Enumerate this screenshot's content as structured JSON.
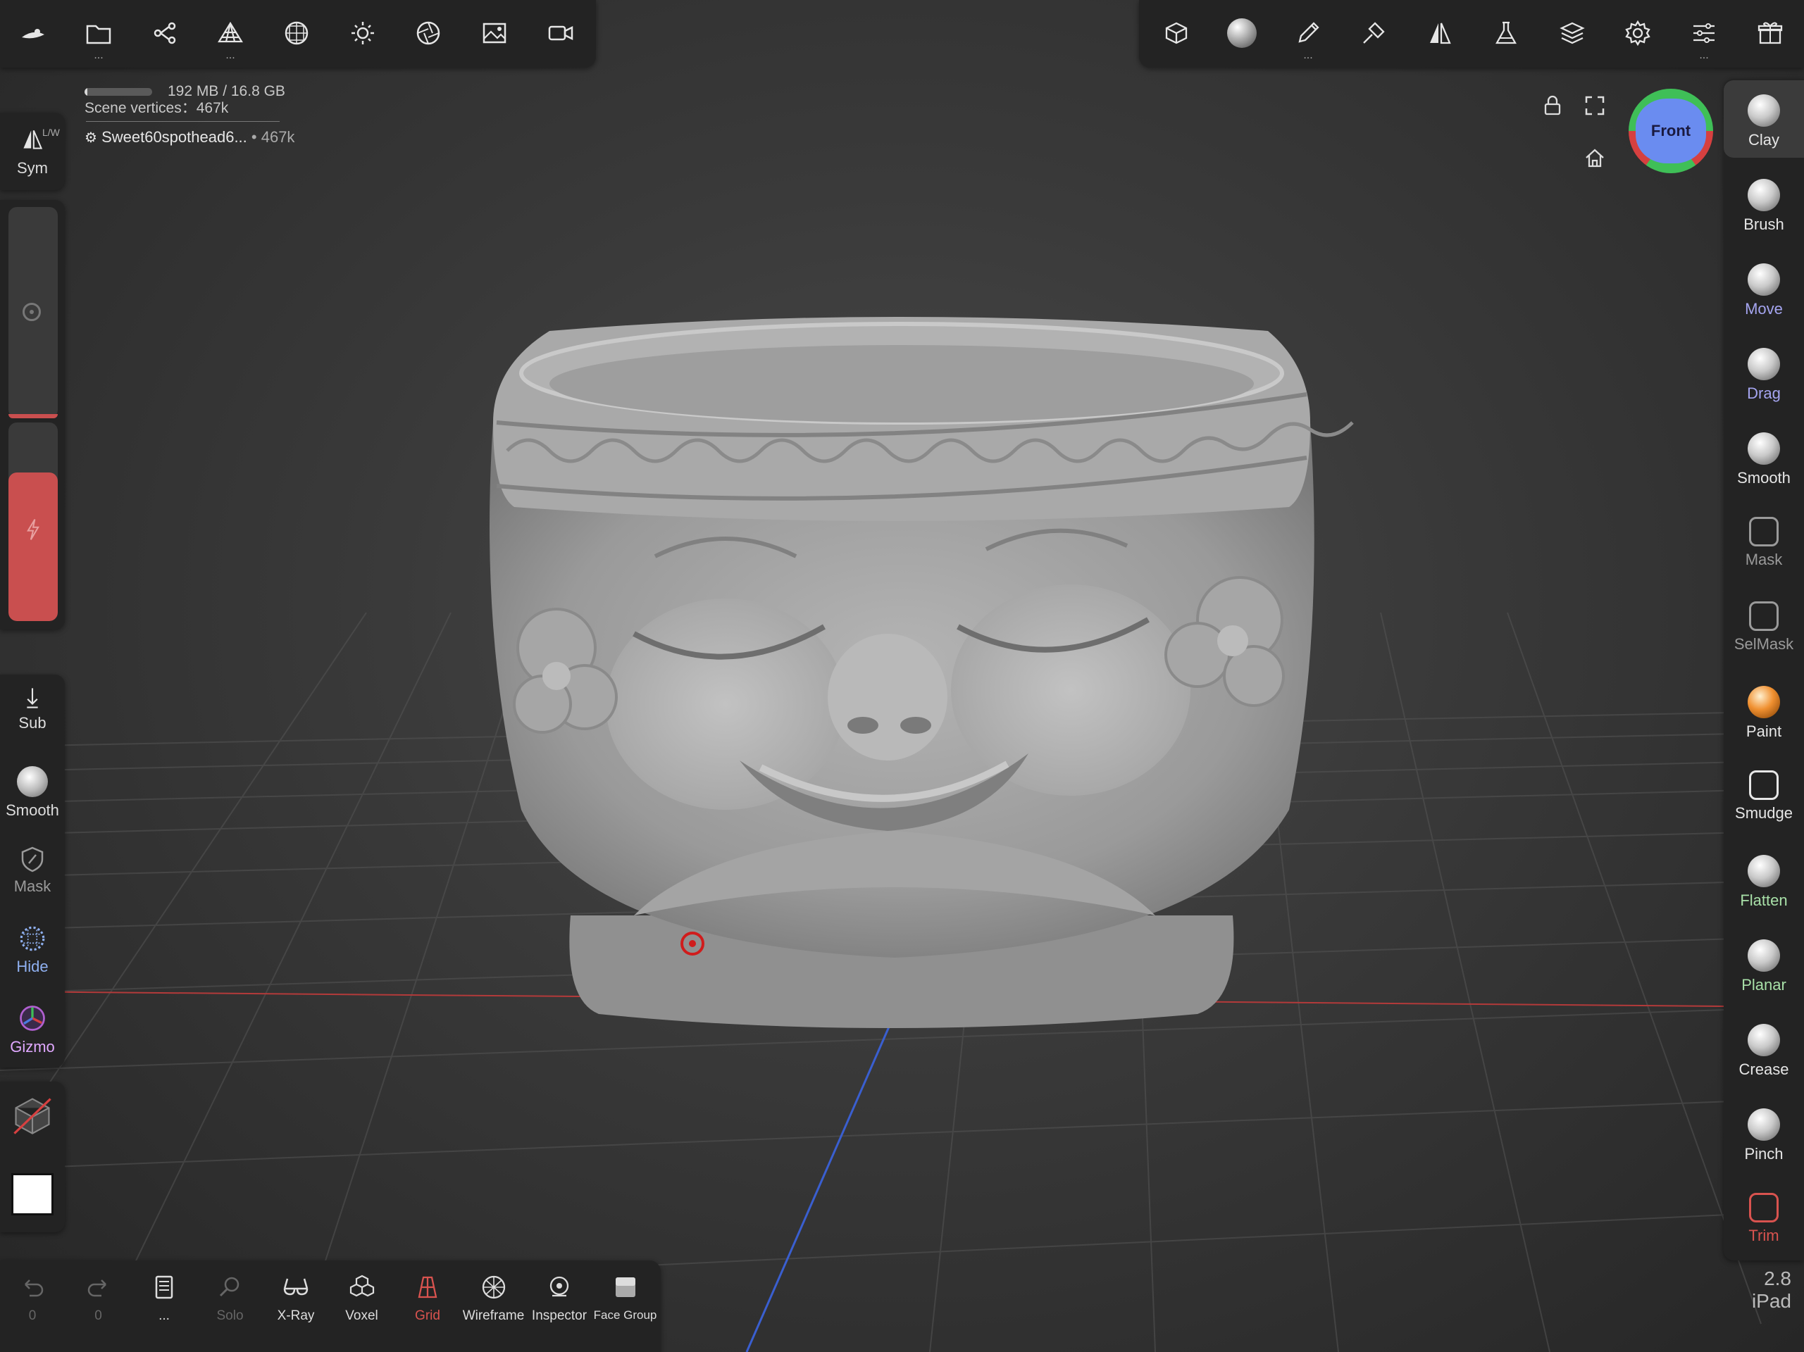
{
  "top_toolbar_left": [
    {
      "icon": "app-logo-icon"
    },
    {
      "icon": "folder-icon"
    },
    {
      "icon": "scene-tree-icon"
    },
    {
      "icon": "multires-icon"
    },
    {
      "icon": "topology-icon"
    },
    {
      "icon": "light-icon"
    },
    {
      "icon": "camera-aperture-icon"
    },
    {
      "icon": "background-image-icon"
    },
    {
      "icon": "video-icon"
    }
  ],
  "top_toolbar_right": [
    {
      "icon": "material-cube-icon"
    },
    {
      "icon": "matcap-sphere-icon"
    },
    {
      "icon": "stroke-pen-icon"
    },
    {
      "icon": "brush-settings-icon"
    },
    {
      "icon": "symmetry-icon"
    },
    {
      "icon": "flask-icon"
    },
    {
      "icon": "layers-icon"
    },
    {
      "icon": "settings-gear-icon"
    },
    {
      "icon": "sliders-icon"
    },
    {
      "icon": "gift-icon"
    }
  ],
  "info": {
    "memory": "192 MB / 16.8 GB",
    "memory_fraction": 0.011,
    "scene_vertices": "Scene vertices：467k",
    "object_name": "Sweet60spothead6...",
    "object_vertices": "• 467k"
  },
  "left_panel": {
    "sym_label": "Sym",
    "sym_badge": "L/W",
    "sub_label": "Sub",
    "smooth_label": "Smooth",
    "mask_label": "Mask",
    "hide_label": "Hide",
    "gizmo_label": "Gizmo",
    "size_fraction": 0.0,
    "intensity_fraction": 0.75
  },
  "right_tools": [
    {
      "label": "Clay",
      "color": "#e6e6e6",
      "selected": true
    },
    {
      "label": "Brush",
      "color": "#e6e6e6"
    },
    {
      "label": "Move",
      "color": "#a5a5f0"
    },
    {
      "label": "Drag",
      "color": "#a5a5f0"
    },
    {
      "label": "Smooth",
      "color": "#e6e6e6"
    },
    {
      "label": "Mask",
      "color": "#9a9a9a"
    },
    {
      "label": "SelMask",
      "color": "#9a9a9a"
    },
    {
      "label": "Paint",
      "color": "#e6e6e6"
    },
    {
      "label": "Smudge",
      "color": "#e6e6e6"
    },
    {
      "label": "Flatten",
      "color": "#a8e0a8"
    },
    {
      "label": "Planar",
      "color": "#a8e0a8"
    },
    {
      "label": "Crease",
      "color": "#e6e6e6"
    },
    {
      "label": "Pinch",
      "color": "#e6e6e6"
    },
    {
      "label": "Trim",
      "color": "#d9534f"
    }
  ],
  "bottom_bar": [
    {
      "label": "0",
      "icon": "undo-icon",
      "style": "dim"
    },
    {
      "label": "0",
      "icon": "redo-icon",
      "style": "dim"
    },
    {
      "label": "...",
      "icon": "history-icon",
      "style": ""
    },
    {
      "label": "Solo",
      "icon": "solo-search-icon",
      "style": "dim"
    },
    {
      "label": "X-Ray",
      "icon": "xray-glasses-icon",
      "style": ""
    },
    {
      "label": "Voxel",
      "icon": "voxel-cubes-icon",
      "style": ""
    },
    {
      "label": "Grid",
      "icon": "grid-icon",
      "style": "red"
    },
    {
      "label": "Wireframe",
      "icon": "wireframe-sphere-icon",
      "style": ""
    },
    {
      "label": "Inspector",
      "icon": "inspector-eye-icon",
      "style": ""
    },
    {
      "label": "Face Group",
      "icon": "face-group-icon",
      "style": ""
    }
  ],
  "view_cube": {
    "face_label": "Front"
  },
  "version": {
    "number": "2.8",
    "device": "iPad"
  },
  "colors": {
    "accent_red": "#c94f4f",
    "panel_bg": "#232323",
    "selected_bg": "#3b3b3b"
  }
}
